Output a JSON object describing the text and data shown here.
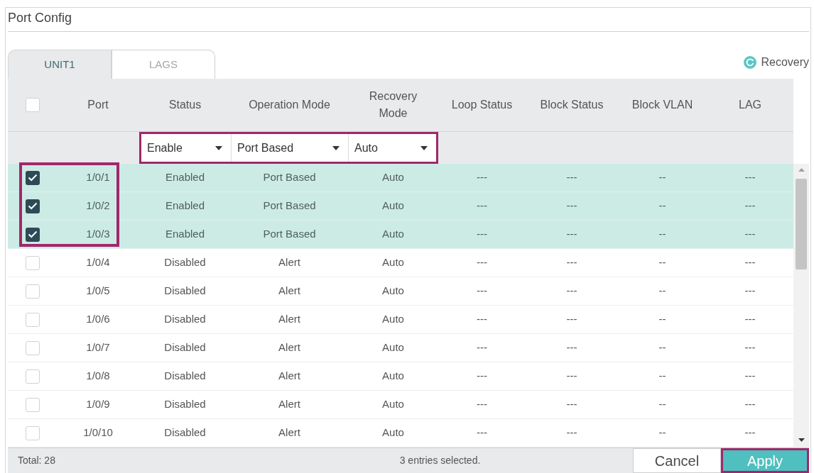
{
  "panel": {
    "title": "Port Config"
  },
  "tabs": [
    {
      "label": "UNIT1",
      "selected": true
    },
    {
      "label": "LAGS",
      "selected": false
    }
  ],
  "recovery_button": {
    "label": "Recovery"
  },
  "table": {
    "select_all": {
      "checked": false
    },
    "columns": [
      "Port",
      "Status",
      "Operation Mode",
      "Recovery Mode",
      "Loop Status",
      "Block Status",
      "Block VLAN",
      "LAG"
    ],
    "filters": {
      "highlighted": true,
      "dropdowns": [
        {
          "value": "Enable"
        },
        {
          "value": "Port Based"
        },
        {
          "value": "Auto"
        }
      ]
    },
    "rows": [
      {
        "selected": true,
        "highlighted": true,
        "cells": [
          "1/0/1",
          "Enabled",
          "Port Based",
          "Auto",
          "---",
          "---",
          "--",
          "---"
        ]
      },
      {
        "selected": true,
        "highlighted": true,
        "cells": [
          "1/0/2",
          "Enabled",
          "Port Based",
          "Auto",
          "---",
          "---",
          "--",
          "---"
        ]
      },
      {
        "selected": true,
        "highlighted": true,
        "cells": [
          "1/0/3",
          "Enabled",
          "Port Based",
          "Auto",
          "---",
          "---",
          "--",
          "---"
        ]
      },
      {
        "selected": false,
        "highlighted": false,
        "cells": [
          "1/0/4",
          "Disabled",
          "Alert",
          "Auto",
          "---",
          "---",
          "--",
          "---"
        ]
      },
      {
        "selected": false,
        "highlighted": false,
        "cells": [
          "1/0/5",
          "Disabled",
          "Alert",
          "Auto",
          "---",
          "---",
          "--",
          "---"
        ]
      },
      {
        "selected": false,
        "highlighted": false,
        "cells": [
          "1/0/6",
          "Disabled",
          "Alert",
          "Auto",
          "---",
          "---",
          "--",
          "---"
        ]
      },
      {
        "selected": false,
        "highlighted": false,
        "cells": [
          "1/0/7",
          "Disabled",
          "Alert",
          "Auto",
          "---",
          "---",
          "--",
          "---"
        ]
      },
      {
        "selected": false,
        "highlighted": false,
        "cells": [
          "1/0/8",
          "Disabled",
          "Alert",
          "Auto",
          "---",
          "---",
          "--",
          "---"
        ]
      },
      {
        "selected": false,
        "highlighted": false,
        "cells": [
          "1/0/9",
          "Disabled",
          "Alert",
          "Auto",
          "---",
          "---",
          "--",
          "---"
        ]
      },
      {
        "selected": false,
        "highlighted": false,
        "cells": [
          "1/0/10",
          "Disabled",
          "Alert",
          "Auto",
          "---",
          "---",
          "--",
          "---"
        ]
      }
    ]
  },
  "footer": {
    "total": "Total: 28",
    "selection_note": "3 entries selected.",
    "buttons": [
      {
        "label": "Cancel",
        "kind": "secondary",
        "highlighted": false
      },
      {
        "label": "Apply",
        "kind": "primary",
        "highlighted": true
      }
    ]
  }
}
